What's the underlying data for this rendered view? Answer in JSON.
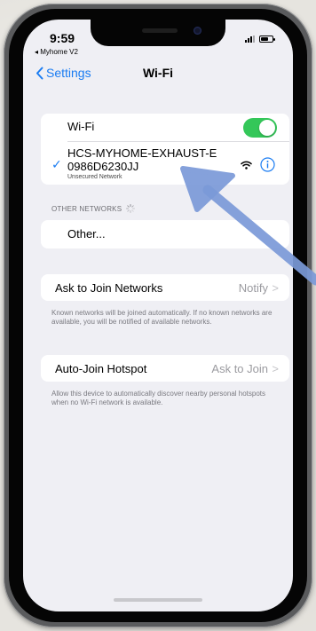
{
  "status_bar": {
    "time": "9:59",
    "back_app": "◂ Myhome V2"
  },
  "nav": {
    "back_label": "Settings",
    "title": "Wi-Fi"
  },
  "wifi": {
    "label": "Wi-Fi",
    "enabled": true,
    "connected_network": {
      "name": "HCS-MYHOME-EXHAUST-E0986D6230JJ",
      "subtitle": "Unsecured Network"
    }
  },
  "other_networks": {
    "header": "OTHER NETWORKS",
    "other_label": "Other..."
  },
  "ask_to_join": {
    "label": "Ask to Join Networks",
    "value": "Notify",
    "chevron": ">",
    "footnote": "Known networks will be joined automatically. If no known networks are available, you will be notified of available networks."
  },
  "auto_join": {
    "label": "Auto-Join Hotspot",
    "value": "Ask to Join",
    "chevron": ">",
    "footnote": "Allow this device to automatically discover nearby personal hotspots when no Wi-Fi network is available."
  },
  "colors": {
    "accent": "#1a7cf2",
    "toggle_on": "#34c759",
    "background": "#efeff4",
    "arrow": "#7b9ad8"
  },
  "icons": [
    "chevron-left-icon",
    "checkmark-icon",
    "wifi-icon",
    "info-icon",
    "spinner-icon",
    "signal-icon",
    "battery-icon"
  ]
}
